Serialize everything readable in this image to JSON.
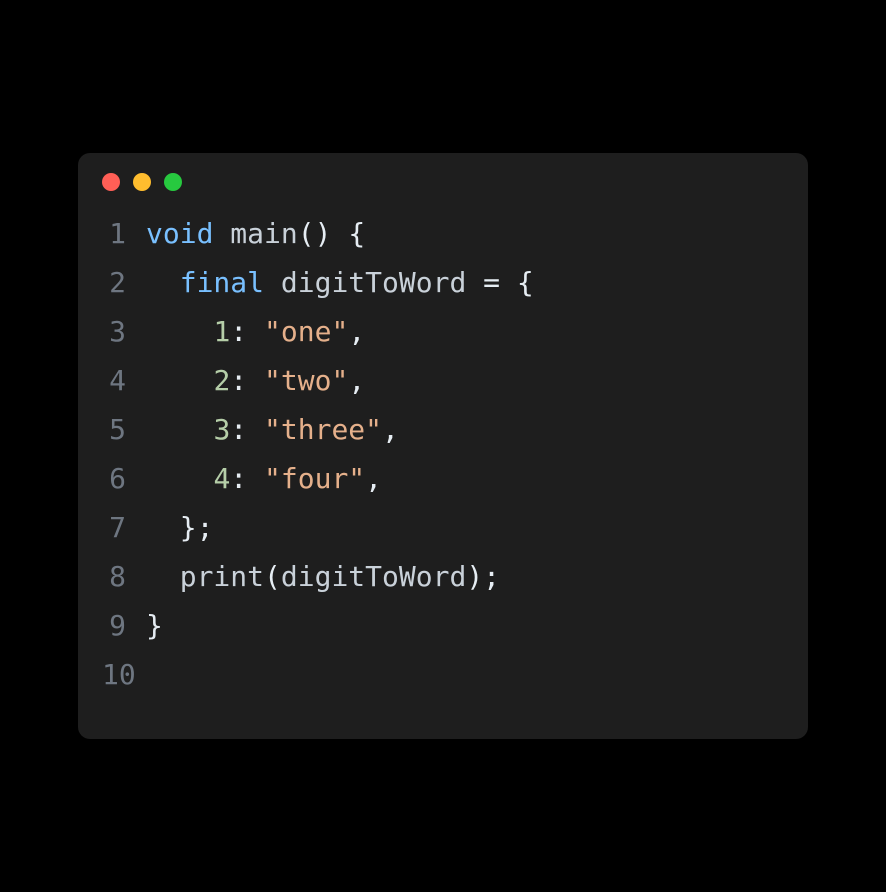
{
  "window": {
    "dots": [
      "red",
      "yellow",
      "green"
    ]
  },
  "lines": {
    "n1": "1",
    "n2": "2",
    "n3": "3",
    "n4": "4",
    "n5": "5",
    "n6": "6",
    "n7": "7",
    "n8": "8",
    "n9": "9",
    "n10": "10"
  },
  "code": {
    "l1": {
      "kw": "void",
      "sp1": " ",
      "fn": "main",
      "paren": "()",
      "sp2": " ",
      "brace": "{"
    },
    "l2": {
      "indent": "  ",
      "kw": "final",
      "sp1": " ",
      "var": "digitToWord",
      "sp2": " ",
      "eq": "=",
      "sp3": " ",
      "brace": "{"
    },
    "l3": {
      "indent": "    ",
      "num": "1",
      "colon": ":",
      "sp": " ",
      "str": "\"one\"",
      "comma": ","
    },
    "l4": {
      "indent": "    ",
      "num": "2",
      "colon": ":",
      "sp": " ",
      "str": "\"two\"",
      "comma": ","
    },
    "l5": {
      "indent": "    ",
      "num": "3",
      "colon": ":",
      "sp": " ",
      "str": "\"three\"",
      "comma": ","
    },
    "l6": {
      "indent": "    ",
      "num": "4",
      "colon": ":",
      "sp": " ",
      "str": "\"four\"",
      "comma": ","
    },
    "l7": {
      "indent": "  ",
      "brace": "}",
      "semi": ";"
    },
    "l8": {
      "indent": "  ",
      "fn": "print",
      "open": "(",
      "arg": "digitToWord",
      "close": ")",
      "semi": ";"
    },
    "l9": {
      "brace": "}"
    },
    "l10": {
      "empty": ""
    }
  }
}
